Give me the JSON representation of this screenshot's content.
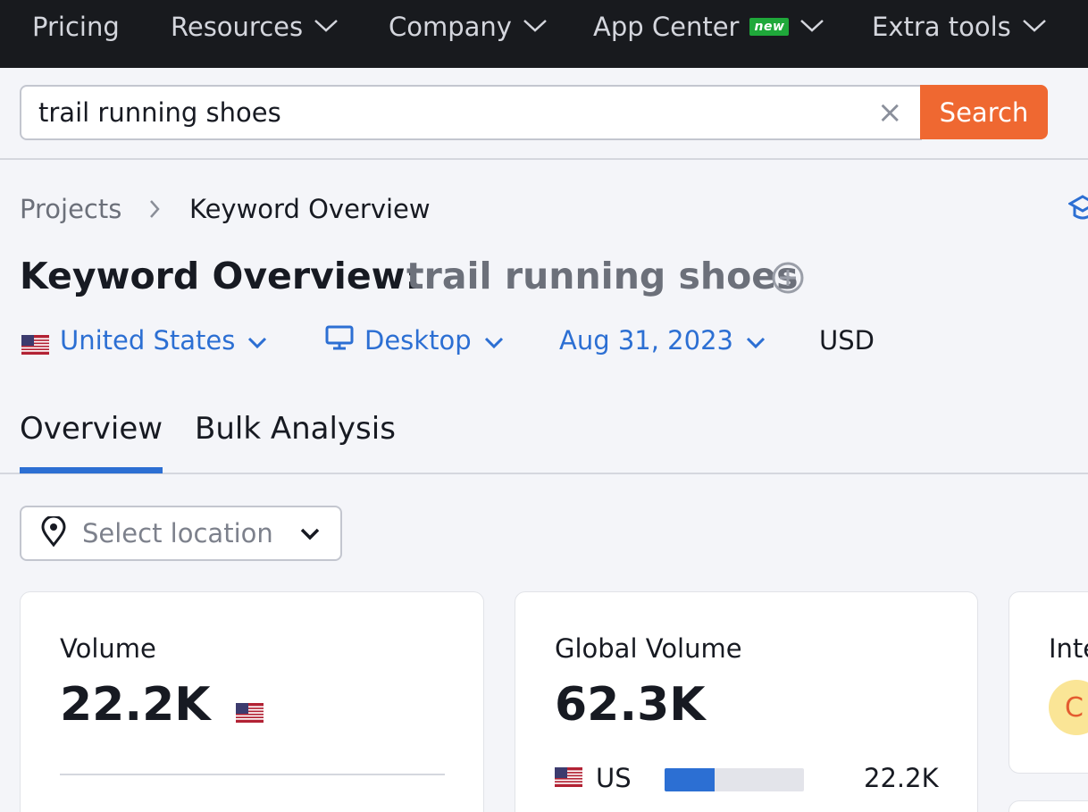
{
  "nav": {
    "items": [
      {
        "label": "Pricing"
      },
      {
        "label": "Resources"
      },
      {
        "label": "Company"
      },
      {
        "label": "App Center",
        "badge": "new"
      },
      {
        "label": "Extra tools"
      }
    ]
  },
  "search": {
    "query": "trail running shoes",
    "button_label": "Search",
    "clear_glyph": "×"
  },
  "breadcrumb": {
    "items": [
      "Projects",
      "Keyword Overview"
    ],
    "separator": "›"
  },
  "page": {
    "title": "Keyword Overview:",
    "keyword": "trail running shoes"
  },
  "filters": {
    "country": "United States",
    "device": "Desktop",
    "date": "Aug 31, 2023",
    "currency": "USD"
  },
  "tabs": [
    {
      "label": "Overview",
      "active": true
    },
    {
      "label": "Bulk Analysis",
      "active": false
    }
  ],
  "location": {
    "placeholder": "Select location"
  },
  "cards": {
    "volume": {
      "label": "Volume",
      "value": "22.2K"
    },
    "global_volume": {
      "label": "Global Volume",
      "value": "62.3K",
      "rows": [
        {
          "country": "US",
          "value": "22.2K",
          "share": 0.356
        }
      ]
    },
    "intent": {
      "label": "Inte",
      "badge": "C"
    }
  },
  "colors": {
    "accent": "#2c6fd3",
    "search_button": "#ef6831",
    "nav_bg": "#181a1e",
    "badge_new": "#1fa83a",
    "intent_badge": "#fae596"
  }
}
